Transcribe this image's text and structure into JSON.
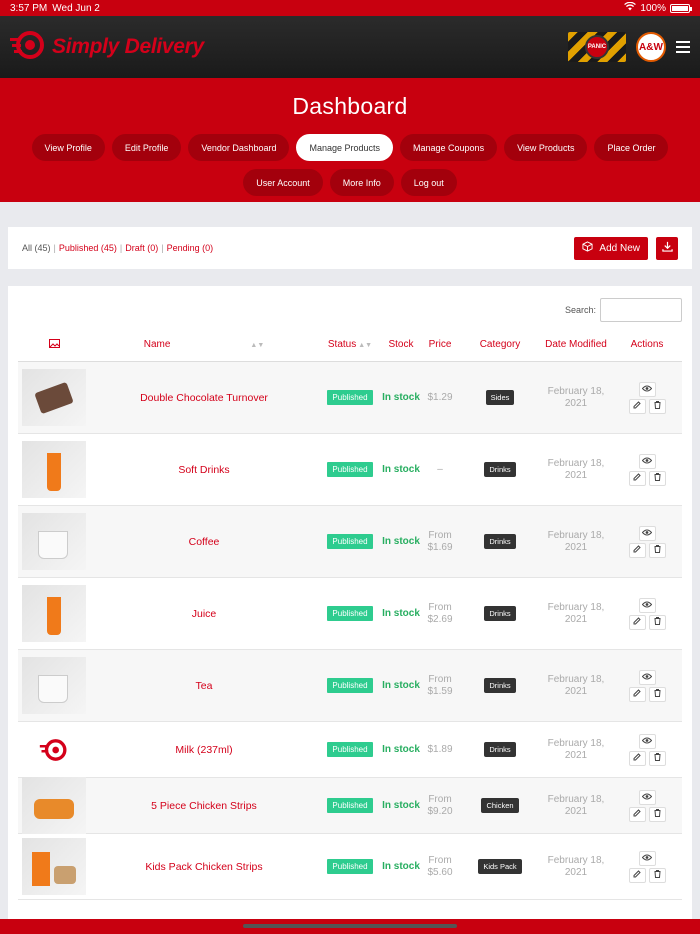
{
  "status_bar": {
    "time": "3:57 PM",
    "date": "Wed Jun 2",
    "battery": "100%"
  },
  "header": {
    "app_name": "Simply Delivery",
    "panic_label": "PANIC",
    "brand_badge": "A&W"
  },
  "dashboard": {
    "title": "Dashboard",
    "nav_row1": [
      "View Profile",
      "Edit Profile",
      "Vendor Dashboard",
      "Manage Products",
      "Manage Coupons",
      "View Products",
      "Place Order"
    ],
    "nav_row2": [
      "User Account",
      "More Info",
      "Log out"
    ],
    "active": "Manage Products"
  },
  "filters": {
    "all": "All (45)",
    "published": "Published (45)",
    "draft": "Draft (0)",
    "pending": "Pending (0)",
    "sep": "|",
    "add_new": "Add New"
  },
  "search": {
    "label": "Search:"
  },
  "table": {
    "headers": {
      "name": "Name",
      "status": "Status",
      "stock": "Stock",
      "price": "Price",
      "category": "Category",
      "date": "Date Modified",
      "actions": "Actions"
    },
    "rows": [
      {
        "name": "Double Chocolate Turnover",
        "status": "Published",
        "stock": "In stock",
        "price": "$1.29",
        "category": "Sides",
        "date": "February 18, 2021",
        "thumb": "turnover"
      },
      {
        "name": "Soft Drinks",
        "status": "Published",
        "stock": "In stock",
        "price": "–",
        "category": "Drinks",
        "date": "February 18, 2021",
        "thumb": "cup"
      },
      {
        "name": "Coffee",
        "status": "Published",
        "stock": "In stock",
        "price": "From $1.69",
        "category": "Drinks",
        "date": "February 18, 2021",
        "thumb": "mug"
      },
      {
        "name": "Juice",
        "status": "Published",
        "stock": "In stock",
        "price": "From $2.69",
        "category": "Drinks",
        "date": "February 18, 2021",
        "thumb": "cup"
      },
      {
        "name": "Tea",
        "status": "Published",
        "stock": "In stock",
        "price": "From $1.59",
        "category": "Drinks",
        "date": "February 18, 2021",
        "thumb": "mug"
      },
      {
        "name": "Milk (237ml)",
        "status": "Published",
        "stock": "In stock",
        "price": "$1.89",
        "category": "Drinks",
        "date": "February 18, 2021",
        "thumb": "logo"
      },
      {
        "name": "5 Piece Chicken Strips",
        "status": "Published",
        "stock": "In stock",
        "price": "From $9.20",
        "category": "Chicken",
        "date": "February 18, 2021",
        "thumb": "strips"
      },
      {
        "name": "Kids Pack Chicken Strips",
        "status": "Published",
        "stock": "In stock",
        "price": "From $5.60",
        "category": "Kids Pack",
        "date": "February 18, 2021",
        "thumb": "pack"
      }
    ]
  },
  "colors": {
    "brand_red": "#c8000f",
    "published_green": "#2ecc8f",
    "stock_green": "#27ae60"
  }
}
